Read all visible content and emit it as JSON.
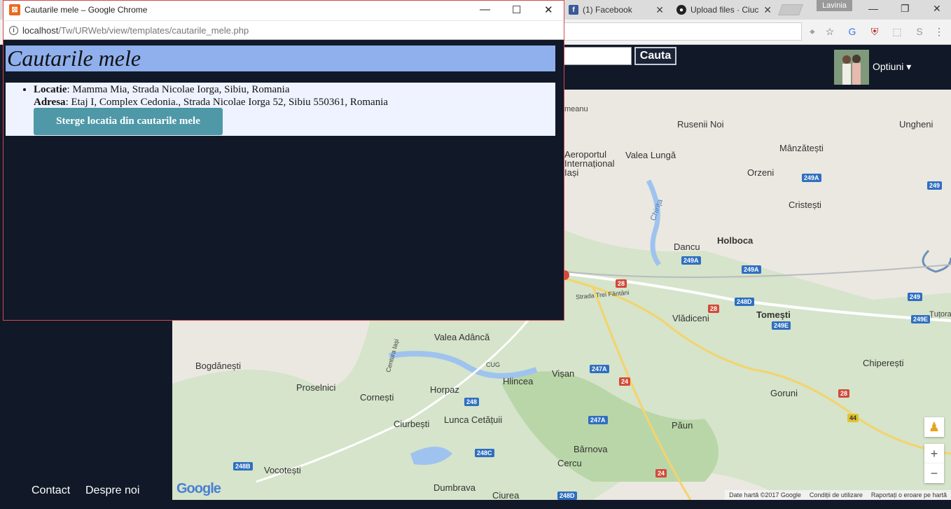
{
  "bg_browser": {
    "tabs": [
      {
        "label": "(1) Facebook",
        "icon": "facebook-icon"
      },
      {
        "label": "Upload files · Ciuc",
        "icon": "github-icon"
      }
    ],
    "profile_name": "Lavinia"
  },
  "site": {
    "search_button": "Cauta",
    "options_label": "Optiuni ▾",
    "footer_links": [
      "Contact",
      "Despre noi"
    ]
  },
  "map": {
    "labels": [
      "Rusenii Noi",
      "Ungheni",
      "Aeroportul Internațional Iași",
      "Valea Lungă",
      "Mânzătești",
      "Orzeni",
      "Cristești",
      "Chirița",
      "Dancu",
      "Holboca",
      "Vlădiceni",
      "Tomești",
      "Țuțora",
      "Valea Adâncă",
      "Bogdănești",
      "Proselnici",
      "Horpaz",
      "Hlincea",
      "Vișan",
      "Chiperești",
      "Cornești",
      "Ciurbești",
      "Lunca Cetățuii",
      "Goruni",
      "Păun",
      "Bârnova",
      "Cercu",
      "Vocotești",
      "Dumbrava",
      "Ciurea",
      "Strada Trei Fântâni",
      "Centura Iași",
      "CUG",
      "meanu"
    ],
    "shields": [
      "249A",
      "249",
      "249A",
      "249A",
      "28",
      "248D",
      "28",
      "249E",
      "249",
      "249E",
      "247A",
      "24",
      "28",
      "248",
      "247A",
      "248C",
      "44",
      "24",
      "248B",
      "248D"
    ],
    "footer": [
      "Date hartă ©2017 Google",
      "Condiții de utilizare",
      "Raportați o eroare pe hartă"
    ],
    "logo": "Google",
    "zoom_in": "+",
    "zoom_out": "−"
  },
  "popup": {
    "window_title": "Cautarile mele – Google Chrome",
    "url_host": "localhost",
    "url_path": "/Tw/URWeb/view/templates/cautarile_mele.php",
    "heading": "Cautarile mele",
    "results": [
      {
        "locatie_label": "Locatie",
        "locatie_value": ": Mamma Mia, Strada Nicolae Iorga, Sibiu, Romania",
        "adresa_label": "Adresa",
        "adresa_value": ": Etaj I, Complex Cedonia., Strada Nicolae Iorga 52, Sibiu 550361, Romania",
        "delete_label": "Sterge locatia din cautarile mele"
      }
    ]
  },
  "colors": {
    "page_bg": "#111827",
    "heading_bg": "#8fb0ec",
    "result_bg": "#eef3ff",
    "button_bg": "#4e98a8",
    "window_border": "#d4494d"
  }
}
